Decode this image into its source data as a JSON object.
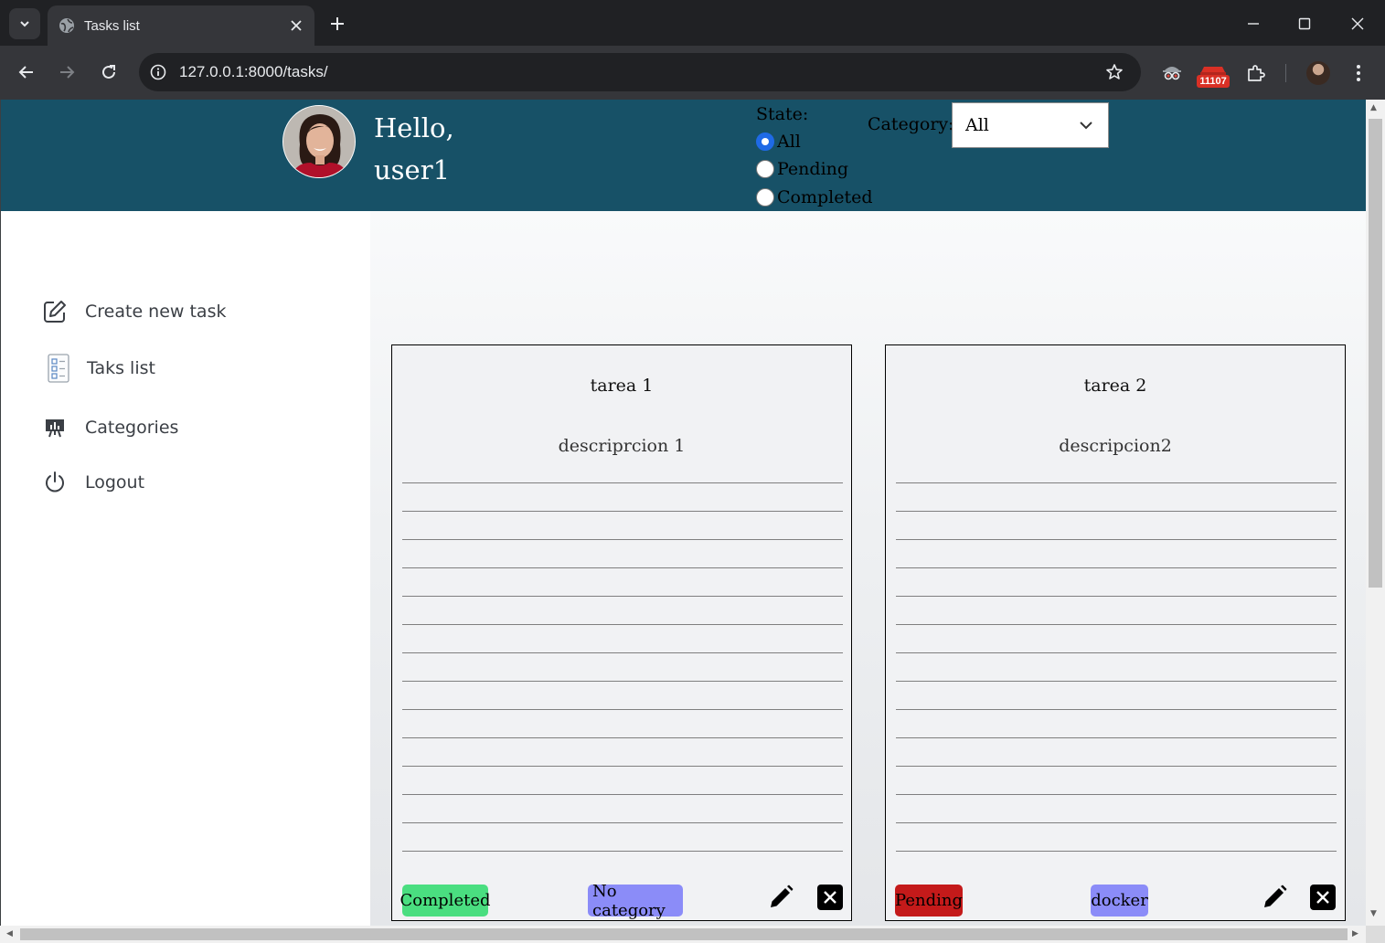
{
  "browser": {
    "tab_title": "Tasks list",
    "url": "127.0.0.1:8000/tasks/",
    "extension_badge": "11107"
  },
  "header": {
    "greeting_line1": "Hello,",
    "greeting_line2": "user1",
    "state_label": "State:",
    "state_options": [
      {
        "label": "All",
        "selected": true
      },
      {
        "label": "Pending",
        "selected": false
      },
      {
        "label": "Completed",
        "selected": false
      }
    ],
    "category_label": "Category:",
    "category_selected": "All"
  },
  "sidebar": {
    "items": [
      {
        "label": "Create new task",
        "icon": "edit-square-icon"
      },
      {
        "label": "Taks list",
        "icon": "checklist-icon"
      },
      {
        "label": "Categories",
        "icon": "presentation-chart-icon"
      },
      {
        "label": "Logout",
        "icon": "power-icon"
      }
    ]
  },
  "tasks": [
    {
      "title": "tarea 1",
      "description": "descriprcion 1",
      "state": "Completed",
      "state_color": "#4ade80",
      "category": "No category",
      "category_color": "#8b8cf8"
    },
    {
      "title": "tarea 2",
      "description": "descripcion2",
      "state": "Pending",
      "state_color": "#c41a1a",
      "category": "docker",
      "category_color": "#8b8cf8"
    }
  ],
  "colors": {
    "header_bg": "#175167",
    "radio_accent": "#1f6ae6"
  }
}
